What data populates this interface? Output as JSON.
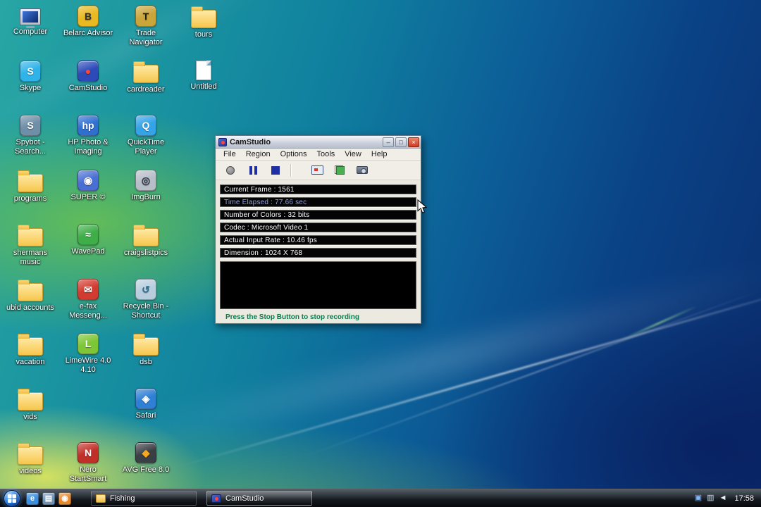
{
  "desktop": {
    "icons": [
      {
        "label": "Computer",
        "icon": "computer-icon",
        "type": "computer",
        "col": 1,
        "row": 1
      },
      {
        "label": "Skype",
        "icon": "skype-icon",
        "type": "app",
        "glyph": "S",
        "color": "#2fb3e8",
        "col": 1,
        "row": 2
      },
      {
        "label": "Spybot - Search...",
        "icon": "spybot-icon",
        "type": "app",
        "glyph": "S",
        "color": "#6f8fa8",
        "col": 1,
        "row": 3
      },
      {
        "label": "programs",
        "icon": "folder-icon",
        "type": "folder",
        "col": 1,
        "row": 4
      },
      {
        "label": "shermans music",
        "icon": "folder-icon",
        "type": "folder",
        "col": 1,
        "row": 5
      },
      {
        "label": "ubid accounts",
        "icon": "folder-icon",
        "type": "folder",
        "col": 1,
        "row": 6
      },
      {
        "label": "vacation",
        "icon": "folder-icon",
        "type": "folder",
        "col": 1,
        "row": 7
      },
      {
        "label": "vids",
        "icon": "folder-icon",
        "type": "folder",
        "col": 1,
        "row": 8
      },
      {
        "label": "videos",
        "icon": "folder-icon",
        "type": "folder",
        "col": 1,
        "row": 9
      },
      {
        "label": "Belarc Advisor",
        "icon": "belarc-advisor-icon",
        "type": "app",
        "glyph": "B",
        "color": "#e8b920",
        "fg": "#253245",
        "col": 2,
        "row": 1
      },
      {
        "label": "CamStudio",
        "icon": "camstudio-icon",
        "type": "app",
        "glyph": "●",
        "color": "#2c4ab8",
        "fg": "#ff4438",
        "col": 2,
        "row": 2
      },
      {
        "label": "HP Photo & Imaging",
        "icon": "hp-photo-icon",
        "type": "app",
        "glyph": "hp",
        "color": "#2f6fd0",
        "col": 2,
        "row": 3
      },
      {
        "label": "SUPER ©",
        "icon": "super-icon",
        "type": "app",
        "glyph": "◉",
        "color": "#4a6fd4",
        "col": 2,
        "row": 4
      },
      {
        "label": "WavePad",
        "icon": "wavepad-icon",
        "type": "app",
        "glyph": "≈",
        "color": "#3fae49",
        "col": 2,
        "row": 5
      },
      {
        "label": "e-fax Messeng...",
        "icon": "efax-icon",
        "type": "app",
        "glyph": "✉",
        "color": "#d23b2f",
        "col": 2,
        "row": 6
      },
      {
        "label": "LimeWire 4.0 4.10",
        "icon": "limewire-icon",
        "type": "app",
        "glyph": "L",
        "color": "#7ec636",
        "col": 2,
        "row": 7
      },
      {
        "label": "Nero StartSmart",
        "icon": "nero-icon",
        "type": "app",
        "glyph": "N",
        "color": "#c03028",
        "col": 2,
        "row": 9
      },
      {
        "label": "Trade Navigator",
        "icon": "trade-navigator-icon",
        "type": "app",
        "glyph": "T",
        "color": "#caa53a",
        "fg": "#1e1e1e",
        "col": 3,
        "row": 1
      },
      {
        "label": "cardreader",
        "icon": "folder-icon",
        "type": "folder",
        "col": 3,
        "row": 2
      },
      {
        "label": "QuickTime Player",
        "icon": "quicktime-icon",
        "type": "app",
        "glyph": "Q",
        "color": "#35a3e8",
        "col": 3,
        "row": 3
      },
      {
        "label": "ImgBurn",
        "icon": "imgburn-icon",
        "type": "app",
        "glyph": "◎",
        "color": "#b8bec8",
        "fg": "#30384a",
        "col": 3,
        "row": 4
      },
      {
        "label": "craigslistpics",
        "icon": "folder-icon",
        "type": "folder",
        "col": 3,
        "row": 5
      },
      {
        "label": "Recycle Bin - Shortcut",
        "icon": "recycle-bin-icon",
        "type": "app",
        "glyph": "↺",
        "color": "#b8cede",
        "fg": "#2f6f8f",
        "col": 3,
        "row": 6
      },
      {
        "label": "dsb",
        "icon": "folder-icon",
        "type": "folder",
        "col": 3,
        "row": 7
      },
      {
        "label": "Safari",
        "icon": "safari-icon",
        "type": "app",
        "glyph": "◈",
        "color": "#2f7fd4",
        "col": 3,
        "row": 8
      },
      {
        "label": "AVG Free 8.0",
        "icon": "avg-icon",
        "type": "app",
        "glyph": "◆",
        "color": "#3a3f46",
        "fg": "#f5a81c",
        "col": 3,
        "row": 9
      },
      {
        "label": "tours",
        "icon": "folder-icon",
        "type": "folder",
        "col": 4,
        "row": 1
      },
      {
        "label": "Untitled",
        "icon": "document-icon",
        "type": "doc",
        "col": 4,
        "row": 2
      }
    ]
  },
  "camstudio": {
    "title": "CamStudio",
    "menus": [
      "File",
      "Region",
      "Options",
      "Tools",
      "View",
      "Help"
    ],
    "window_buttons": [
      {
        "name": "minimize-button",
        "glyph": "–"
      },
      {
        "name": "maximize-button",
        "glyph": "□"
      },
      {
        "name": "close-button",
        "glyph": "×"
      }
    ],
    "stats": [
      {
        "text": "Current Frame : 1561",
        "color": "#ffffff"
      },
      {
        "text": "Time Elapsed : 77.66 sec",
        "color": "#8fa0e8"
      },
      {
        "text": "Number of Colors : 32 bits",
        "color": "#ffffff"
      },
      {
        "text": "Codec : Microsoft Video 1",
        "color": "#ffffff"
      },
      {
        "text": "Actual Input Rate : 10.46 fps",
        "color": "#ffffff"
      },
      {
        "text": "Dimension : 1024 X 768",
        "color": "#ffffff"
      }
    ],
    "status_text": "Press the Stop Button to stop recording"
  },
  "taskbar": {
    "quicklaunch": [
      {
        "name": "internet-explorer-icon",
        "glyph": "e",
        "color": "#3a8fe0"
      },
      {
        "name": "show-desktop-icon",
        "glyph": "▤",
        "color": "#6f93b8"
      },
      {
        "name": "media-player-icon",
        "glyph": "◉",
        "color": "#e8882a"
      }
    ],
    "tasks": [
      {
        "label": "Fishing",
        "icon": "folder",
        "active": false
      },
      {
        "label": "CamStudio",
        "icon": "camstudio",
        "active": true
      }
    ],
    "tray_icons": [
      {
        "name": "camstudio-tray-icon",
        "glyph": "▣",
        "fg": "#7fb8ff"
      },
      {
        "name": "network-icon",
        "glyph": "▥",
        "fg": "#cfe0f0"
      },
      {
        "name": "volume-icon",
        "glyph": "◄",
        "fg": "#e8f0f8"
      }
    ],
    "clock": "17:58"
  }
}
